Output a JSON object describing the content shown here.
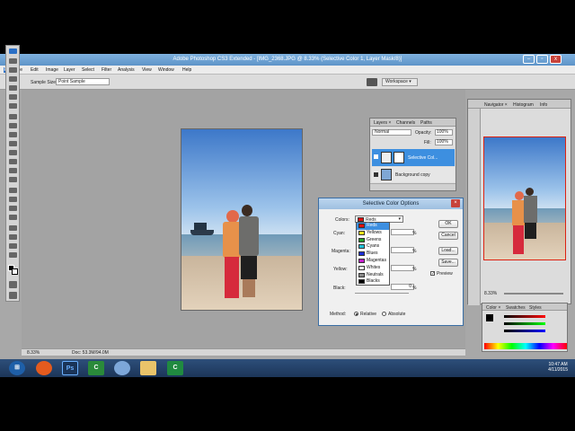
{
  "window": {
    "title": "Adobe Photoshop CS3 Extended - [IMG_2368.JPG @ 8.33% (Selective Color 1, Layer Mask/8)]",
    "minimize": "–",
    "restore": "▫",
    "close": "x"
  },
  "menu": [
    "File",
    "Edit",
    "Image",
    "Layer",
    "Select",
    "Filter",
    "Analysis",
    "View",
    "Window",
    "Help"
  ],
  "options": {
    "sample_size_label": "Sample Size:",
    "sample_size_value": "Point Sample",
    "workspace": "Workspace ▾"
  },
  "layers_panel": {
    "tabs": [
      "Layers ×",
      "Channels",
      "Paths"
    ],
    "blend_mode": "Normal",
    "opacity_label": "Opacity:",
    "opacity": "100%",
    "fill_label": "Fill:",
    "fill": "100%",
    "layer1": "Selective Col...",
    "layer2": "Background copy"
  },
  "navigator": {
    "tabs": [
      "Navigator ×",
      "Histogram",
      "Info"
    ],
    "zoom": "8.33%"
  },
  "color_panel": {
    "tabs": [
      "Color ×",
      "Swatches",
      "Styles"
    ]
  },
  "status": {
    "zoom": "8.33%",
    "doc": "Doc: 53.3M/94.0M"
  },
  "dialog": {
    "title": "Selective Color Options",
    "colors_label": "Colors:",
    "colors_value": "Reds",
    "cyan_label": "Cyan:",
    "magenta_label": "Magenta:",
    "yellow_label": "Yellow:",
    "black_label": "Black:",
    "pct": "%",
    "black_value": "0",
    "ok": "OK",
    "cancel": "Cancel",
    "load": "Load...",
    "save": "Save...",
    "preview": "Preview",
    "method_label": "Method:",
    "relative": "Relative",
    "absolute": "Absolute"
  },
  "color_options": [
    {
      "label": "Reds",
      "color": "#e01010"
    },
    {
      "label": "Yellows",
      "color": "#f2e21a"
    },
    {
      "label": "Greens",
      "color": "#22a02a"
    },
    {
      "label": "Cyans",
      "color": "#21c4dc"
    },
    {
      "label": "Blues",
      "color": "#1a2ed6"
    },
    {
      "label": "Magentas",
      "color": "#c21fc8"
    },
    {
      "label": "Whites",
      "color": "#ffffff"
    },
    {
      "label": "Neutrals",
      "color": "#888888"
    },
    {
      "label": "Blacks",
      "color": "#000000"
    }
  ],
  "taskbar": {
    "time": "10:47 AM",
    "date": "4/11/2015"
  },
  "accent": "#3d8fe0"
}
